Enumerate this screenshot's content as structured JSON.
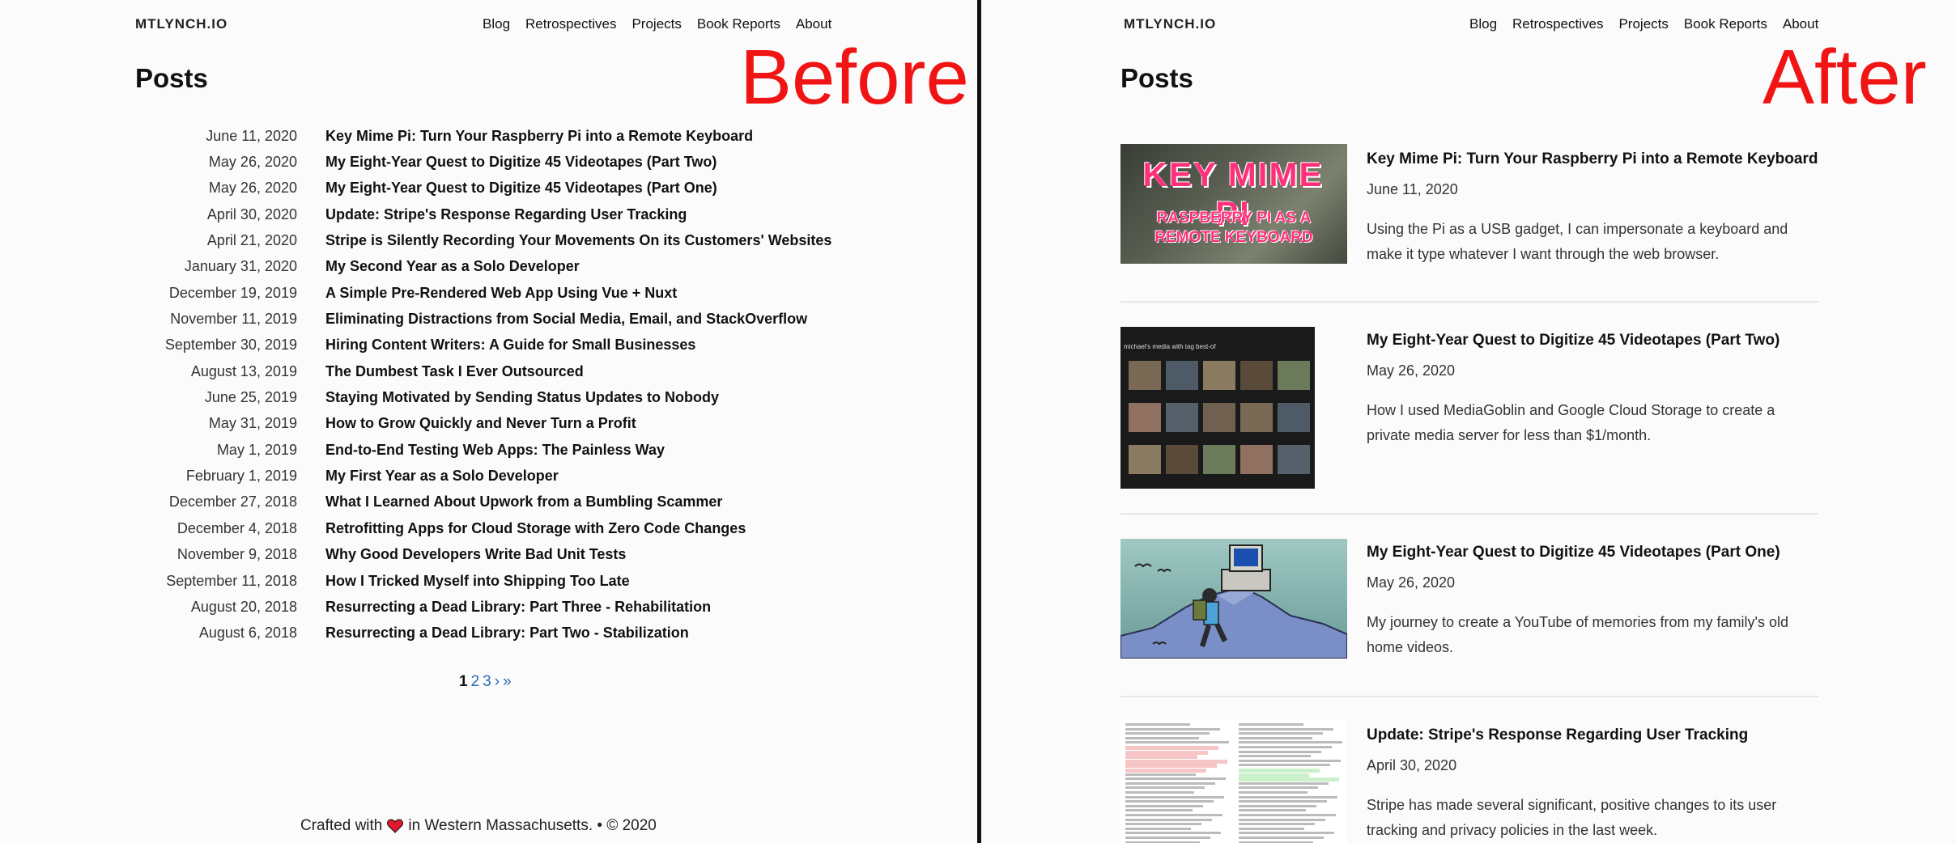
{
  "before": {
    "brand": "MTLYNCH.IO",
    "nav": [
      "Blog",
      "Retrospectives",
      "Projects",
      "Book Reports",
      "About"
    ],
    "label": "Before",
    "heading": "Posts",
    "posts": [
      {
        "date": "June 11, 2020",
        "title": "Key Mime Pi: Turn Your Raspberry Pi into a Remote Keyboard"
      },
      {
        "date": "May 26, 2020",
        "title": "My Eight-Year Quest to Digitize 45 Videotapes (Part Two)"
      },
      {
        "date": "May 26, 2020",
        "title": "My Eight-Year Quest to Digitize 45 Videotapes (Part One)"
      },
      {
        "date": "April 30, 2020",
        "title": "Update: Stripe's Response Regarding User Tracking"
      },
      {
        "date": "April 21, 2020",
        "title": "Stripe is Silently Recording Your Movements On its Customers' Websites"
      },
      {
        "date": "January 31, 2020",
        "title": "My Second Year as a Solo Developer"
      },
      {
        "date": "December 19, 2019",
        "title": "A Simple Pre-Rendered Web App Using Vue + Nuxt"
      },
      {
        "date": "November 11, 2019",
        "title": "Eliminating Distractions from Social Media, Email, and StackOverflow"
      },
      {
        "date": "September 30, 2019",
        "title": "Hiring Content Writers: A Guide for Small Businesses"
      },
      {
        "date": "August 13, 2019",
        "title": "The Dumbest Task I Ever Outsourced"
      },
      {
        "date": "June 25, 2019",
        "title": "Staying Motivated by Sending Status Updates to Nobody"
      },
      {
        "date": "May 31, 2019",
        "title": "How to Grow Quickly and Never Turn a Profit"
      },
      {
        "date": "May 1, 2019",
        "title": "End-to-End Testing Web Apps: The Painless Way"
      },
      {
        "date": "February 1, 2019",
        "title": "My First Year as a Solo Developer"
      },
      {
        "date": "December 27, 2018",
        "title": "What I Learned About Upwork from a Bumbling Scammer"
      },
      {
        "date": "December 4, 2018",
        "title": "Retrofitting Apps for Cloud Storage with Zero Code Changes"
      },
      {
        "date": "November 9, 2018",
        "title": "Why Good Developers Write Bad Unit Tests"
      },
      {
        "date": "September 11, 2018",
        "title": "How I Tricked Myself into Shipping Too Late"
      },
      {
        "date": "August 20, 2018",
        "title": "Resurrecting a Dead Library: Part Three - Rehabilitation"
      },
      {
        "date": "August 6, 2018",
        "title": "Resurrecting a Dead Library: Part Two - Stabilization"
      }
    ],
    "pagination": {
      "current": "1",
      "pages": [
        "2",
        "3"
      ],
      "next": "›",
      "last": "»"
    },
    "footer": {
      "prefix": "Crafted with",
      "suffix": "in Western Massachusetts. • © 2020"
    }
  },
  "after": {
    "brand": "MTLYNCH.IO",
    "nav": [
      "Blog",
      "Retrospectives",
      "Projects",
      "Book Reports",
      "About"
    ],
    "label": "After",
    "heading": "Posts",
    "posts": [
      {
        "title": "Key Mime Pi: Turn Your Raspberry Pi into a Remote Keyboard",
        "date": "June 11, 2020",
        "description": "Using the Pi as a USB gadget, I can impersonate a keyboard and make it type whatever I want through the web browser.",
        "thumb_text_1": "KEY MIME PI",
        "thumb_text_2": "RASPBERRY PI AS A REMOTE KEYBOARD"
      },
      {
        "title": "My Eight-Year Quest to Digitize 45 Videotapes (Part Two)",
        "date": "May 26, 2020",
        "description": "How I used MediaGoblin and Google Cloud Storage to create a private media server for less than $1/month.",
        "thumb_caption": "michael's media with tag best-of"
      },
      {
        "title": "My Eight-Year Quest to Digitize 45 Videotapes (Part One)",
        "date": "May 26, 2020",
        "description": "My journey to create a YouTube of memories from my family's old home videos."
      },
      {
        "title": "Update: Stripe's Response Regarding User Tracking",
        "date": "April 30, 2020",
        "description": "Stripe has made several significant, positive changes to its user tracking and privacy policies in the last week."
      }
    ]
  },
  "colors": {
    "accent_red": "#f01414",
    "link_blue": "#2b6cb0",
    "heart": "#e0182d",
    "keymime_pink": "#ff2f7a"
  }
}
